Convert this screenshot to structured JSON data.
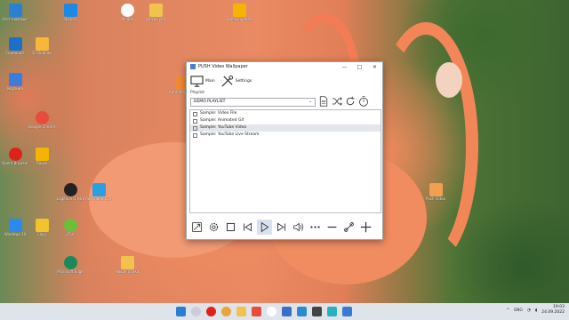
{
  "window": {
    "title": "PUSH Video Wallpaper",
    "minimize": "—",
    "maximize": "□",
    "close": "✕"
  },
  "toolbar": {
    "main_label": "Main",
    "settings_label": "Settings"
  },
  "playlist": {
    "label": "Playlist",
    "selected": "DEMO PLAYLIST",
    "items": [
      "Sample: Video File",
      "Sample: Animated Gif",
      "Sample: YouTube Video",
      "Sample: YouTube Live Stream"
    ],
    "selected_index": 2
  },
  "desktop_icons": [
    {
      "label": "Этот компьютер",
      "color": "#2d7fd3"
    },
    {
      "label": "Disk-O",
      "color": "#1e88e5"
    },
    {
      "label": "Yandex",
      "color": "#ffffff"
    },
    {
      "label": "для ютуба",
      "color": "#f2c14e"
    },
    {
      "label": "Samsung Kies",
      "color": "#f5b400"
    },
    {
      "label": "Скриншот",
      "color": "#1e6fc6"
    },
    {
      "label": "1С Bubbles",
      "color": "#f6b73c"
    },
    {
      "label": "Корзина",
      "color": "#3b7dd8"
    },
    {
      "label": "Google Chrome",
      "color": "#e74c3c"
    },
    {
      "label": "Opera Browser",
      "color": "#e0201b"
    },
    {
      "label": "Поиск",
      "color": "#f4b400"
    },
    {
      "label": "Logitech G HUB",
      "color": "#222222"
    },
    {
      "label": "AVS Video Converter",
      "color": "#2aa0e0"
    },
    {
      "label": "Clipy",
      "color": "#f2c230"
    },
    {
      "label": "uTorr",
      "color": "#6bbf3a"
    },
    {
      "label": "Windows 10",
      "color": "#2d89ef"
    },
    {
      "label": "Microsoft Edge",
      "color": "#1b8a5a"
    },
    {
      "label": "Новая папка",
      "color": "#f2c14e"
    },
    {
      "label": "Autodesk Fusion",
      "color": "#f08a30"
    },
    {
      "label": "Push Video",
      "color": "#f0a050"
    }
  ],
  "taskbar": {
    "language": "ENG",
    "time": "19:03",
    "date": "24.09.2022"
  }
}
